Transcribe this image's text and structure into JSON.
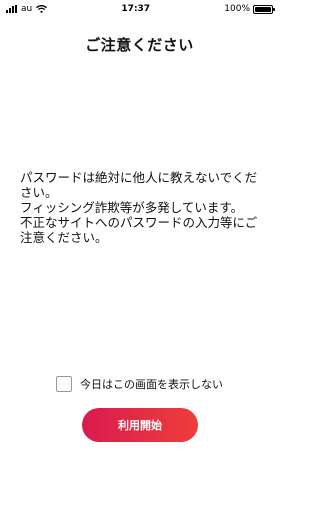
{
  "status_bar": {
    "carrier": "au",
    "time": "17:37",
    "battery_percent": "100%",
    "battery_level": 1.0,
    "signal_icon": "signal-bars-icon",
    "wifi_icon": "wifi-icon",
    "battery_icon": "battery-charging-icon"
  },
  "page": {
    "title": "ご注意ください"
  },
  "message": {
    "lines": [
      "パスワードは絶対に他人に教えないでください。",
      "フィッシング詐欺等が多発しています。",
      "不正なサイトへのパスワードの入力等にご注意ください。"
    ]
  },
  "options": {
    "dont_show_label": "今日はこの画面を表示しない",
    "dont_show_checked": false
  },
  "actions": {
    "start_label": "利用開始"
  },
  "colors": {
    "button_gradient_start": "#d81b4f",
    "button_gradient_end": "#ee3e3a"
  }
}
